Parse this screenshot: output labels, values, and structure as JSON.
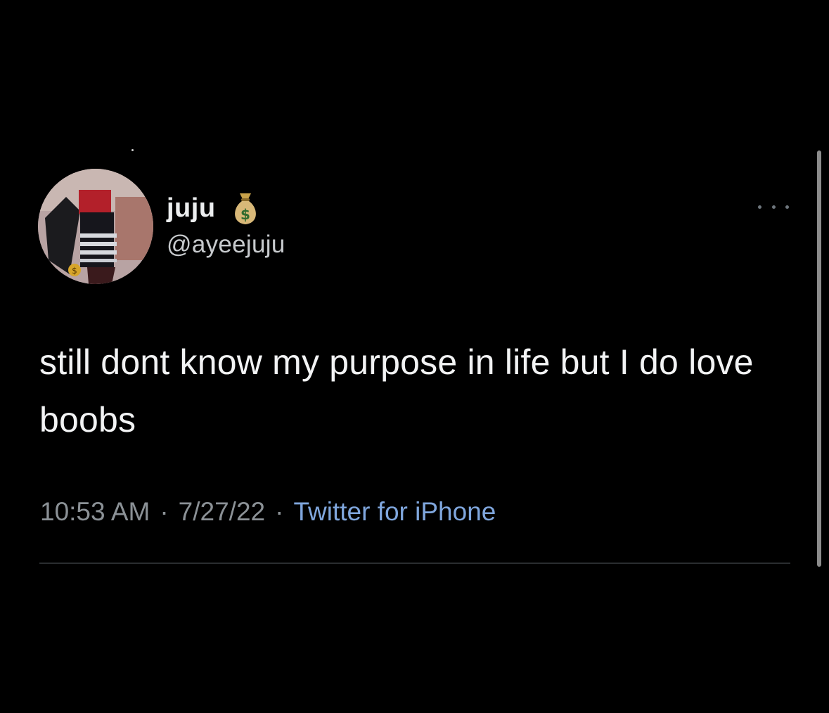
{
  "tweet": {
    "author": {
      "display_name": "juju",
      "name_badge_icon": "money-bag-icon",
      "handle": "@ayeejuju"
    },
    "more_icon": "more-horizontal-icon",
    "text": "still dont know my purpose in life but I do love boobs",
    "meta": {
      "time": "10:53 AM",
      "separator": "·",
      "date": "7/27/22",
      "source": "Twitter for iPhone"
    }
  },
  "colors": {
    "background": "#000000",
    "text_primary": "#f2f3f4",
    "text_secondary": "#8b9196",
    "link": "#7fa6dd",
    "divider": "#2a2d30"
  }
}
